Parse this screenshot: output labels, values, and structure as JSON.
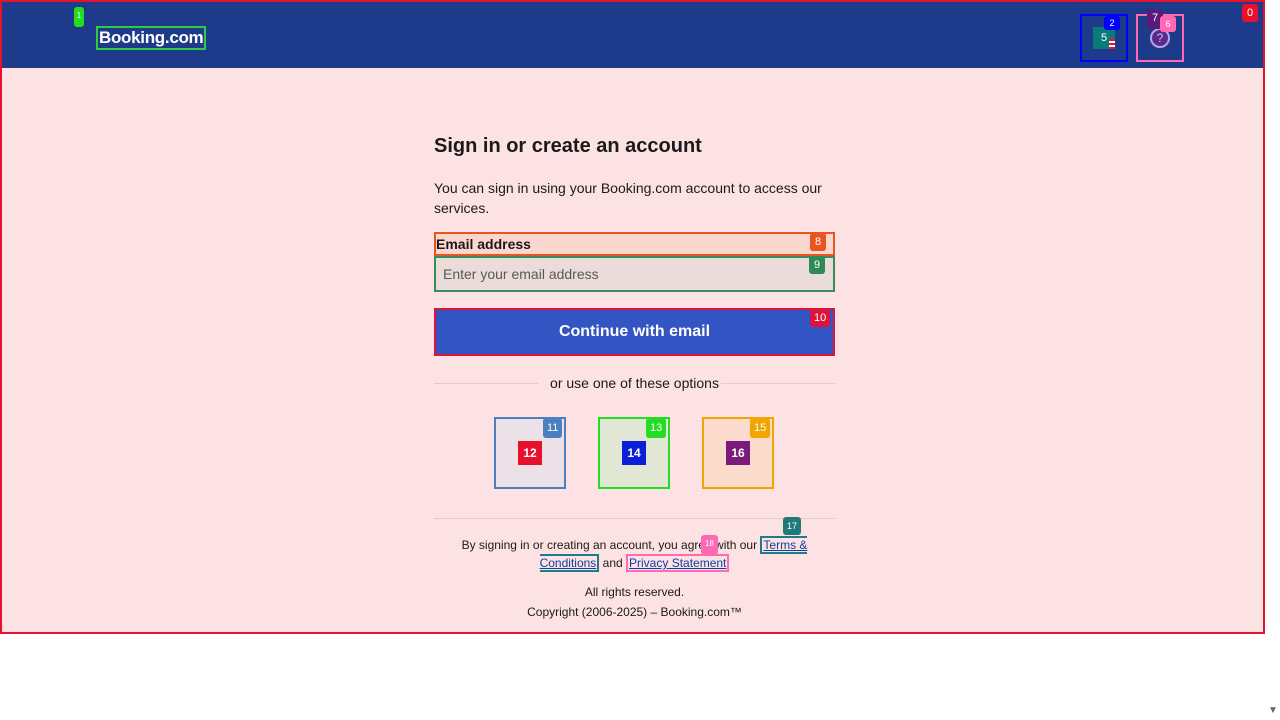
{
  "header": {
    "logo_text": "Booking.com",
    "currency_flag_label": "5",
    "help_icon_glyph": "?"
  },
  "main": {
    "title": "Sign in or create an account",
    "subtitle": "You can sign in using your Booking.com account to access our services.",
    "email_label": "Email address",
    "email_placeholder": "Enter your email address",
    "email_value": "",
    "continue_label": "Continue with email",
    "divider_text": "or use one of these options",
    "social_options": [
      {
        "label": "12",
        "icon": "google-icon"
      },
      {
        "label": "14",
        "icon": "apple-icon"
      },
      {
        "label": "16",
        "icon": "facebook-icon"
      }
    ]
  },
  "footer": {
    "legal_prefix": "By signing in or creating an account, you agree with our",
    "terms_link": "Terms & Conditions",
    "legal_and": "and",
    "privacy_link": "Privacy Statement",
    "rights": "All rights reserved.",
    "copyright": "Copyright (2006-2025) – Booking.com™"
  },
  "badges": [
    "0",
    "1",
    "2",
    "5",
    "7",
    "6",
    "8",
    "9",
    "10",
    "11",
    "12",
    "13",
    "14",
    "15",
    "16",
    "17",
    "18"
  ],
  "colors": {
    "header_bg": "#1e3a8a",
    "page_bg": "#fde2e4",
    "primary_button": "#3355c4",
    "link": "#0a3fa0"
  }
}
